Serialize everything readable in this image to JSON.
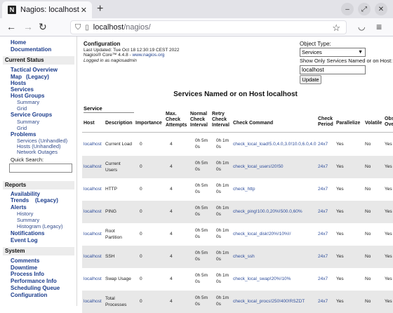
{
  "browser": {
    "tab_title": "Nagios: localhost",
    "favicon_letter": "N",
    "close_glyph": "✕",
    "new_tab_glyph": "+",
    "url_host": "localhost",
    "url_path": "/nagios/",
    "icons": [
      "back-icon",
      "forward-icon",
      "reload-icon",
      "shield-icon",
      "page-icon",
      "star-icon",
      "pocket-icon",
      "menu-icon"
    ]
  },
  "sidebar": {
    "top_links": [
      "Home",
      "Documentation"
    ],
    "current_status": {
      "heading": "Current Status",
      "tactical": "Tactical Overview",
      "map": "Map",
      "map_legacy": "(Legacy)",
      "hosts": "Hosts",
      "services": "Services",
      "host_groups": "Host Groups",
      "hg_summary": "Summary",
      "hg_grid": "Grid",
      "service_groups": "Service Groups",
      "sg_summary": "Summary",
      "sg_grid": "Grid",
      "problems": "Problems",
      "services_unhandled": "Services (Unhandled)",
      "hosts_unhandled": "Hosts (Unhandled)",
      "network_outages": "Network Outages",
      "quick_search": "Quick Search:"
    },
    "reports": {
      "heading": "Reports",
      "availability": "Availability",
      "trends": "Trends",
      "trends_legacy": "(Legacy)",
      "alerts": "Alerts",
      "history": "History",
      "summary": "Summary",
      "histogram": "Histogram (Legacy)",
      "notifications": "Notifications",
      "event_log": "Event Log"
    },
    "system": {
      "heading": "System",
      "comments": "Comments",
      "downtime": "Downtime",
      "process_info": "Process Info",
      "performance_info": "Performance Info",
      "scheduling_queue": "Scheduling Queue",
      "configuration": "Configuration"
    }
  },
  "main": {
    "config_title": "Configuration",
    "last_updated": "Last Updated: Tue Oct 18 12:30:19 CEST 2022",
    "version_prefix": "Nagios® Core™ 4.4.8 - ",
    "version_link": "www.nagios.org",
    "logged_in": "Logged in as nagiosadmin",
    "object_type_label": "Object Type:",
    "object_type_value": "Services",
    "filter_label": "Show Only Services Named or on Host:",
    "filter_value": "localhost",
    "update_label": "Update",
    "table_title": "Services Named or on Host localhost",
    "service_label": "Service"
  },
  "table": {
    "headers": {
      "host": "Host",
      "description": "Description",
      "importance": "Importance",
      "max_check": "Max. Check Attempts",
      "normal_check": "Normal Check Interval",
      "retry_check": "Retry Check Interval",
      "check_command": "Check Command",
      "check_period": "Check Period",
      "parallelize": "Parallelize",
      "volatile": "Volatile",
      "obsess": "Obs Ove"
    },
    "rows": [
      {
        "host": "localhost",
        "desc1": "Current Load",
        "desc2": "",
        "importance": "0",
        "max": "4",
        "normal1": "0h 5m",
        "normal2": "0s",
        "retry1": "0h 1m",
        "retry2": "0s",
        "command": "check_local_load!5.0,4.0,3.0!10.0,6.0,4.0",
        "period": "24x7",
        "parallelize": "Yes",
        "volatile": "No",
        "obsess": "Yes"
      },
      {
        "host": "localhost",
        "desc1": "Current",
        "desc2": "Users",
        "importance": "0",
        "max": "4",
        "normal1": "0h 5m",
        "normal2": "0s",
        "retry1": "0h 1m",
        "retry2": "0s",
        "command": "check_local_users!20!50",
        "period": "24x7",
        "parallelize": "Yes",
        "volatile": "No",
        "obsess": "Yes"
      },
      {
        "host": "localhost",
        "desc1": "HTTP",
        "desc2": "",
        "importance": "0",
        "max": "4",
        "normal1": "0h 5m",
        "normal2": "0s",
        "retry1": "0h 1m",
        "retry2": "0s",
        "command": "check_http",
        "period": "24x7",
        "parallelize": "Yes",
        "volatile": "No",
        "obsess": "Yes"
      },
      {
        "host": "localhost",
        "desc1": "PING",
        "desc2": "",
        "importance": "0",
        "max": "4",
        "normal1": "0h 5m",
        "normal2": "0s",
        "retry1": "0h 1m",
        "retry2": "0s",
        "command": "check_ping!100.0,20%!500.0,60%",
        "period": "24x7",
        "parallelize": "Yes",
        "volatile": "No",
        "obsess": "Yes"
      },
      {
        "host": "localhost",
        "desc1": "Root",
        "desc2": "Partition",
        "importance": "0",
        "max": "4",
        "normal1": "0h 5m",
        "normal2": "0s",
        "retry1": "0h 1m",
        "retry2": "0s",
        "command": "check_local_disk!20%!10%!/",
        "period": "24x7",
        "parallelize": "Yes",
        "volatile": "No",
        "obsess": "Yes"
      },
      {
        "host": "localhost",
        "desc1": "SSH",
        "desc2": "",
        "importance": "0",
        "max": "4",
        "normal1": "0h 5m",
        "normal2": "0s",
        "retry1": "0h 1m",
        "retry2": "0s",
        "command": "check_ssh",
        "period": "24x7",
        "parallelize": "Yes",
        "volatile": "No",
        "obsess": "Yes"
      },
      {
        "host": "localhost",
        "desc1": "Swap Usage",
        "desc2": "",
        "importance": "0",
        "max": "4",
        "normal1": "0h 5m",
        "normal2": "0s",
        "retry1": "0h 1m",
        "retry2": "0s",
        "command": "check_local_swap!20%!10%",
        "period": "24x7",
        "parallelize": "Yes",
        "volatile": "No",
        "obsess": "Yes"
      },
      {
        "host": "localhost",
        "desc1": "Total",
        "desc2": "Processes",
        "importance": "0",
        "max": "4",
        "normal1": "0h 5m",
        "normal2": "0s",
        "retry1": "0h 1m",
        "retry2": "0s",
        "command": "check_local_procs!250!400!RSZDT",
        "period": "24x7",
        "parallelize": "Yes",
        "volatile": "No",
        "obsess": "Yes"
      }
    ]
  }
}
